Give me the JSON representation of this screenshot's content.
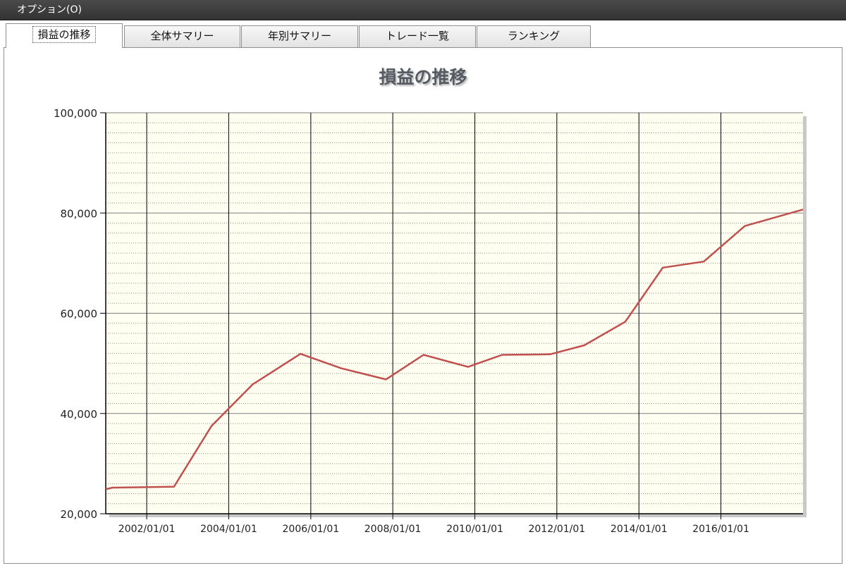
{
  "menu": {
    "options_label": "オプション(O)"
  },
  "tabs": [
    {
      "label": "損益の推移",
      "active": true
    },
    {
      "label": "全体サマリー",
      "active": false
    },
    {
      "label": "年別サマリー",
      "active": false
    },
    {
      "label": "トレード一覧",
      "active": false
    },
    {
      "label": "ランキング",
      "active": false
    }
  ],
  "colors": {
    "plot_background": "#fefef1",
    "series_line": "#c0504d",
    "menubar": "#3c3c3c"
  },
  "chart_data": {
    "type": "line",
    "title": "損益の推移",
    "xlabel": "",
    "ylabel": "",
    "x_tick_labels": [
      "2002/01/01",
      "2004/01/01",
      "2006/01/01",
      "2008/01/01",
      "2010/01/01",
      "2012/01/01",
      "2014/01/01",
      "2016/01/01"
    ],
    "x_ticks": [
      "2002-01-01",
      "2004-01-01",
      "2006-01-01",
      "2008-01-01",
      "2010-01-01",
      "2012-01-01",
      "2014-01-01",
      "2016-01-01"
    ],
    "xlim": [
      "2001-01-01",
      "2018-01-01"
    ],
    "y_tick_labels": [
      "20,000",
      "40,000",
      "60,000",
      "80,000",
      "100,000"
    ],
    "y_ticks": [
      20000,
      40000,
      60000,
      80000,
      100000
    ],
    "ylim": [
      20000,
      100000
    ],
    "grid": {
      "vertical": true,
      "horizontal_major": true,
      "horizontal_minor": "dotted"
    },
    "series": [
      {
        "x": [
          "2001-01-01",
          "2001-03-01",
          "2002-01-01",
          "2002-09-01",
          "2003-08-01",
          "2004-08-01",
          "2005-10-01",
          "2006-10-01",
          "2007-11-01",
          "2008-10-01",
          "2009-11-01",
          "2010-09-01",
          "2011-11-01",
          "2012-09-01",
          "2013-09-01",
          "2014-08-01",
          "2015-08-01",
          "2016-08-01",
          "2018-01-01"
        ],
        "values": [
          24900,
          25200,
          25300,
          25400,
          37500,
          45800,
          51900,
          49000,
          46800,
          51700,
          49300,
          51700,
          51800,
          53600,
          58300,
          69100,
          70300,
          77400,
          80700
        ]
      }
    ]
  }
}
